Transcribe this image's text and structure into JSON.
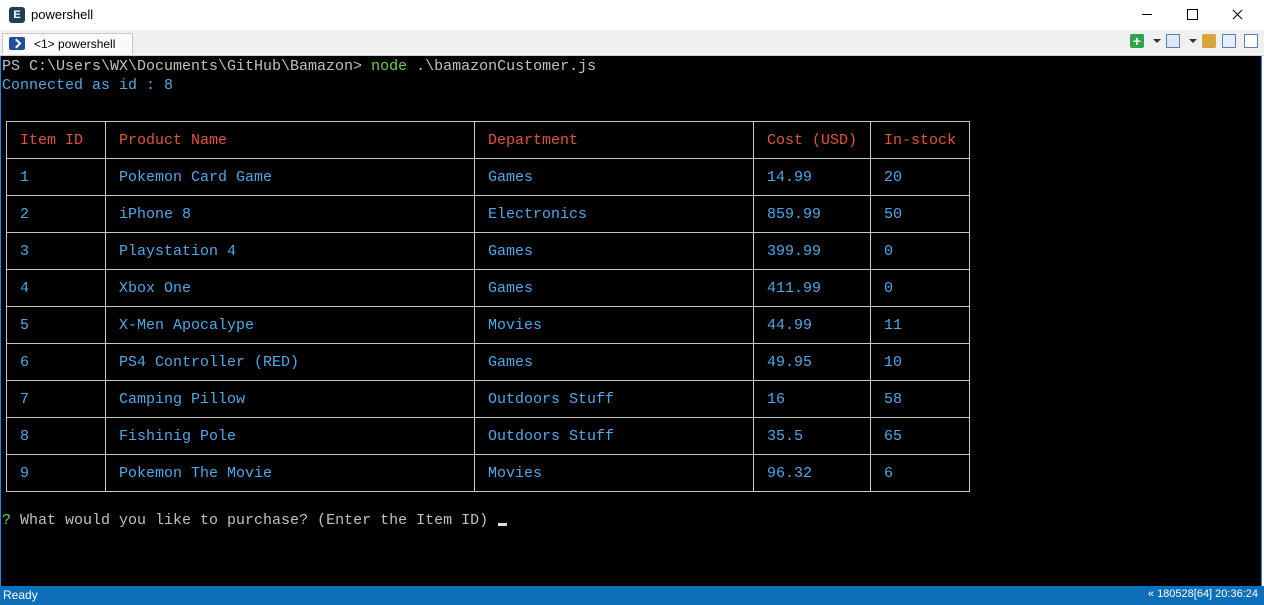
{
  "window": {
    "title": "powershell",
    "app_icon_letter": "E"
  },
  "tabs": [
    {
      "label": "<1> powershell"
    }
  ],
  "console": {
    "command_line": {
      "prompt": "PS C:\\Users\\WX\\Documents\\GitHub\\Bamazon> ",
      "command": "node",
      "argument": " .\\bamazonCustomer.js"
    },
    "connected_line": "Connected as id : 8",
    "table": {
      "headers": [
        "Item ID",
        "Product Name",
        "Department",
        "Cost (USD)",
        "In-stock"
      ],
      "rows": [
        [
          "1",
          "Pokemon Card Game",
          "Games",
          "14.99",
          "20"
        ],
        [
          "2",
          "iPhone 8",
          "Electronics",
          "859.99",
          "50"
        ],
        [
          "3",
          "Playstation 4",
          "Games",
          "399.99",
          "0"
        ],
        [
          "4",
          "Xbox One",
          "Games",
          "411.99",
          "0"
        ],
        [
          "5",
          "X-Men Apocalype",
          "Movies",
          "44.99",
          "11"
        ],
        [
          "6",
          "PS4 Controller (RED)",
          "Games",
          "49.95",
          "10"
        ],
        [
          "7",
          "Camping Pillow",
          "Outdoors Stuff",
          "16",
          "58"
        ],
        [
          "8",
          "Fishinig Pole",
          "Outdoors Stuff",
          "35.5",
          "65"
        ],
        [
          "9",
          "Pokemon The Movie",
          "Movies",
          "96.32",
          "6"
        ]
      ]
    },
    "prompt": {
      "marker": "?",
      "question": " What would you like to purchase? (Enter the Item ID)"
    }
  },
  "statusbar": {
    "left": "Ready",
    "right": "« 180528[64] 20:36:24"
  },
  "colors": {
    "header_text": "#e0553a",
    "cell_text": "#4fa8e8",
    "command": "#6bd14f",
    "status_bg": "#0c6fb8"
  }
}
